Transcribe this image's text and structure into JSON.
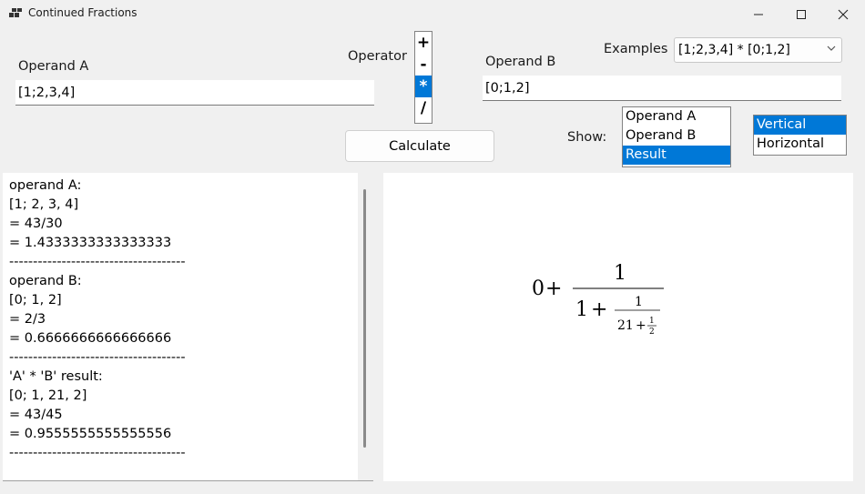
{
  "window": {
    "title": "Continued Fractions",
    "icon": "app-grid-icon",
    "controls": [
      "minimize-icon",
      "maximize-icon",
      "close-icon"
    ]
  },
  "operand_a": {
    "label": "Operand A",
    "value": "[1;2,3,4]"
  },
  "operand_b": {
    "label": "Operand B",
    "value": "[0;1,2]"
  },
  "operator": {
    "label": "Operator",
    "options": [
      "+",
      "-",
      "*",
      "/"
    ],
    "selected": "*"
  },
  "calculate_button": "Calculate",
  "examples": {
    "label": "Examples",
    "selected": "[1;2,3,4] * [0;1,2]"
  },
  "show": {
    "label": "Show:",
    "options": [
      "Operand A",
      "Operand B",
      "Result"
    ],
    "selected": "Result"
  },
  "orientation": {
    "options": [
      "Vertical",
      "Horizontal"
    ],
    "selected": "Vertical"
  },
  "output_lines": [
    "operand A:",
    "[1; 2, 3, 4]",
    "= 43/30",
    "= 1.4333333333333333",
    "-------------------------------------",
    "operand B:",
    "[0; 1, 2]",
    "= 2/3",
    "= 0.6666666666666666",
    "-------------------------------------",
    "'A' * 'B' result:",
    "[0; 1, 21, 2]",
    "= 43/45",
    "= 0.9555555555555556",
    "-------------------------------------"
  ],
  "formula": {
    "a0": "0",
    "plus": "+",
    "one": "1",
    "a1": "1",
    "a2": "21",
    "a3": "2"
  },
  "colors": {
    "selection": "#0078d7",
    "background": "#f0f0f0"
  }
}
